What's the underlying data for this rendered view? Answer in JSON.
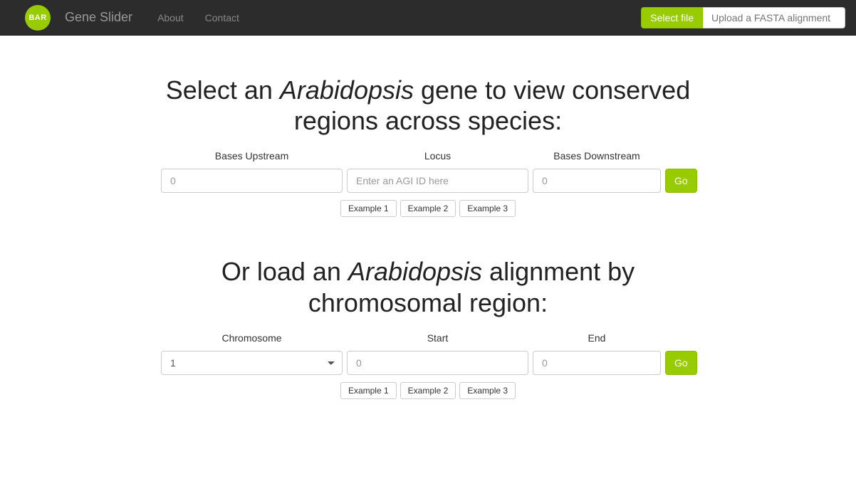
{
  "navbar": {
    "logo_text": "BAR",
    "brand": "Gene Slider",
    "links": {
      "about": "About",
      "contact": "Contact"
    },
    "select_file": "Select file",
    "upload_placeholder": "Upload a FASTA alignment"
  },
  "gene_section": {
    "heading_pre": "Select an ",
    "heading_italic": "Arabidopsis",
    "heading_post": " gene to view conserved regions across species:",
    "labels": {
      "upstream": "Bases Upstream",
      "locus": "Locus",
      "downstream": "Bases Downstream"
    },
    "placeholders": {
      "upstream": "0",
      "locus": "Enter an AGI ID here",
      "downstream": "0"
    },
    "go": "Go",
    "examples": [
      "Example 1",
      "Example 2",
      "Example 3"
    ]
  },
  "region_section": {
    "heading_pre": "Or load an ",
    "heading_italic": "Arabidopsis",
    "heading_post": " alignment by chromosomal region:",
    "labels": {
      "chromosome": "Chromosome",
      "start": "Start",
      "end": "End"
    },
    "chromosome_value": "1",
    "placeholders": {
      "start": "0",
      "end": "0"
    },
    "go": "Go",
    "examples": [
      "Example 1",
      "Example 2",
      "Example 3"
    ]
  }
}
